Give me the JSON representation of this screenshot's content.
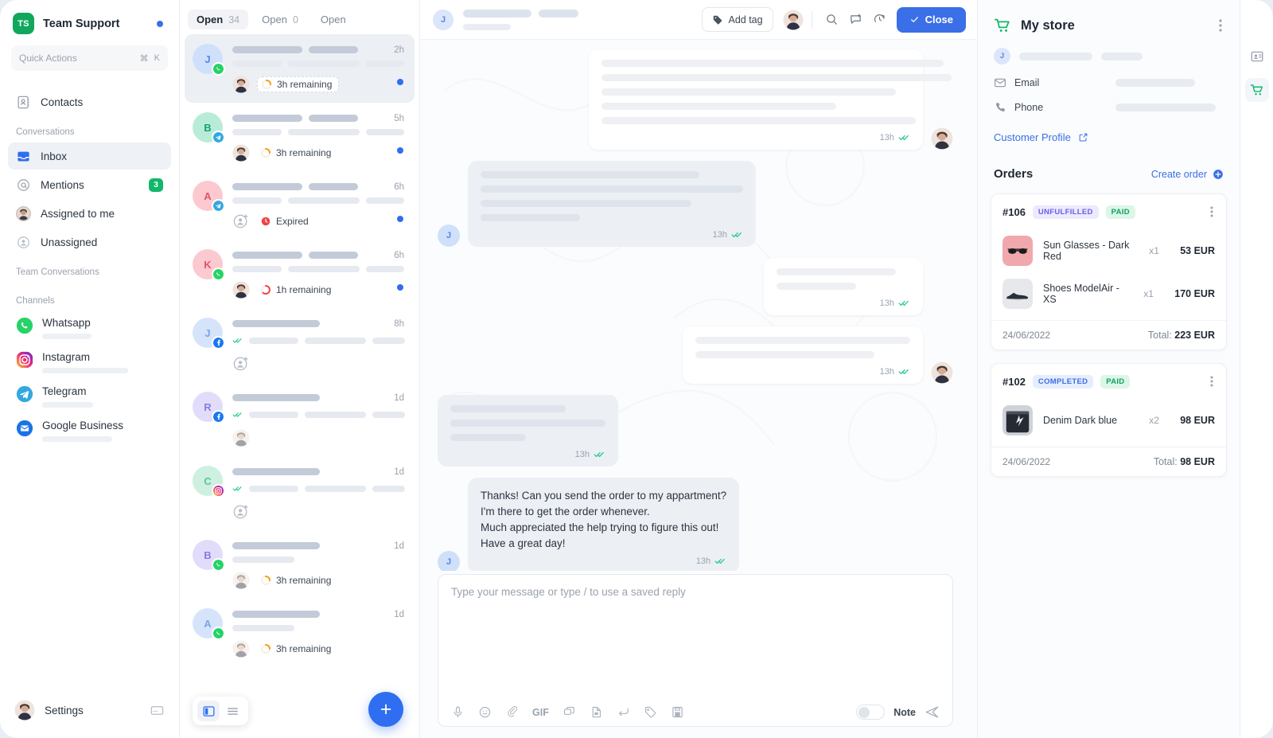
{
  "brand": {
    "logo_text": "TS",
    "name": "Team Support",
    "status_dot_color": "#3b6fe8"
  },
  "quick_actions": {
    "placeholder": "Quick Actions",
    "shortcut_cmd": "⌘",
    "shortcut_key": "K"
  },
  "sidebar": {
    "top_items": [
      {
        "label": "Contacts",
        "icon": "contacts-icon"
      }
    ],
    "conversations_section": "Conversations",
    "conversation_items": [
      {
        "label": "Inbox",
        "icon": "inbox-icon",
        "active": true,
        "badge": ""
      },
      {
        "label": "Mentions",
        "icon": "mention-icon",
        "active": false,
        "badge": "3"
      },
      {
        "label": "Assigned to me",
        "icon": "avatar-icon",
        "active": false,
        "badge": ""
      },
      {
        "label": "Unassigned",
        "icon": "unassigned-icon",
        "active": false,
        "badge": ""
      }
    ],
    "team_section": "Team Conversations",
    "channels_section": "Channels",
    "channels": [
      {
        "label": "Whatsapp",
        "icon": "whatsapp-icon",
        "sub_width": 62
      },
      {
        "label": "Instagram",
        "icon": "instagram-icon",
        "sub_width": 108
      },
      {
        "label": "Telegram",
        "icon": "telegram-icon",
        "sub_width": 64
      },
      {
        "label": "Google Business",
        "icon": "google-business-icon",
        "sub_width": 88
      }
    ],
    "settings_label": "Settings"
  },
  "conversation_list": {
    "tabs": [
      {
        "label": "Open",
        "count": "34",
        "active": true
      },
      {
        "label": "Open",
        "count": "0",
        "active": false
      },
      {
        "label": "Open",
        "count": "",
        "active": false
      }
    ],
    "rows": [
      {
        "initial": "J",
        "avatar_bg": "#cfe0fb",
        "avatar_fg": "#5b85e8",
        "channel": "whatsapp-icon",
        "time": "2h",
        "status_text": "3h remaining",
        "status_icon": "clock-orange-icon",
        "status_style": "dashed",
        "assignee": "photo",
        "unread": true,
        "selected": true,
        "ticks": false
      },
      {
        "initial": "B",
        "avatar_bg": "#b9ecd8",
        "avatar_fg": "#17a26a",
        "channel": "telegram-icon",
        "time": "5h",
        "status_text": "3h remaining",
        "status_icon": "clock-orange-icon",
        "status_style": "plain",
        "assignee": "photo",
        "unread": true,
        "selected": false,
        "ticks": false
      },
      {
        "initial": "A",
        "avatar_bg": "#fbc9cf",
        "avatar_fg": "#e0536a",
        "channel": "telegram-icon",
        "time": "6h",
        "status_text": "Expired",
        "status_icon": "clock-red-icon",
        "status_style": "plain",
        "assignee": "add",
        "unread": true,
        "selected": false,
        "ticks": false
      },
      {
        "initial": "K",
        "avatar_bg": "#fbc9cf",
        "avatar_fg": "#e0536a",
        "channel": "whatsapp-icon",
        "time": "6h",
        "status_text": "1h remaining",
        "status_icon": "clock-red-ring-icon",
        "status_style": "plain",
        "assignee": "photo",
        "unread": true,
        "selected": false,
        "ticks": false
      },
      {
        "initial": "J",
        "avatar_bg": "#d6e4fb",
        "avatar_fg": "#7ea3e8",
        "channel": "facebook-icon",
        "time": "8h",
        "status_text": "",
        "status_icon": "",
        "status_style": "none",
        "assignee": "add",
        "unread": false,
        "selected": false,
        "ticks": true
      },
      {
        "initial": "R",
        "avatar_bg": "#e2dcfb",
        "avatar_fg": "#8b7ae0",
        "channel": "facebook-icon",
        "time": "1d",
        "status_text": "",
        "status_icon": "",
        "status_style": "none",
        "assignee": "photo-faded",
        "unread": false,
        "selected": false,
        "ticks": true
      },
      {
        "initial": "C",
        "avatar_bg": "#cdf0e0",
        "avatar_fg": "#5cc49a",
        "channel": "instagram-icon",
        "time": "1d",
        "status_text": "",
        "status_icon": "",
        "status_style": "none",
        "assignee": "add",
        "unread": false,
        "selected": false,
        "ticks": true
      },
      {
        "initial": "B",
        "avatar_bg": "#e2dcfb",
        "avatar_fg": "#8b7ae0",
        "channel": "whatsapp-icon",
        "time": "1d",
        "status_text": "3h remaining",
        "status_icon": "clock-orange-icon",
        "status_style": "plain",
        "assignee": "photo-faded",
        "unread": false,
        "selected": false,
        "ticks": false
      },
      {
        "initial": "A",
        "avatar_bg": "#d6e4fb",
        "avatar_fg": "#7ea3e8",
        "channel": "whatsapp-icon",
        "time": "1d",
        "status_text": "3h remaining",
        "status_icon": "clock-orange-icon",
        "status_style": "plain",
        "assignee": "photo-faded",
        "unread": false,
        "selected": false,
        "ticks": false
      }
    ],
    "new_conversation_label": "+"
  },
  "chat": {
    "header": {
      "avatar_initial": "J",
      "add_tag_label": "Add tag",
      "close_label": "Close"
    },
    "messages": [
      {
        "dir": "out",
        "type": "skeleton",
        "lines": [
          430,
          440,
          370,
          295,
          395
        ],
        "time": "13h",
        "ticks": true,
        "avatar": "photo"
      },
      {
        "dir": "in",
        "type": "skeleton",
        "lines": [
          275,
          330,
          265,
          125
        ],
        "time": "13h",
        "ticks": true,
        "avatar": "initial"
      },
      {
        "dir": "out",
        "type": "skeleton",
        "lines": [
          150,
          100
        ],
        "time": "13h",
        "ticks": true,
        "avatar": "none"
      },
      {
        "dir": "out",
        "type": "skeleton",
        "lines": [
          270,
          225
        ],
        "time": "13h",
        "ticks": true,
        "avatar": "photo"
      },
      {
        "dir": "in",
        "type": "skeleton",
        "lines": [
          145,
          195,
          95
        ],
        "time": "13h",
        "ticks": true,
        "avatar": "none"
      },
      {
        "dir": "in",
        "type": "text",
        "text": "Thanks! Can you send the order to my appartment?\nI'm there to get the order whenever.\nMuch appreciated the help trying to figure this out!\nHave a great day!",
        "time": "13h",
        "ticks": true,
        "avatar": "initial"
      }
    ],
    "composer": {
      "placeholder": "Type your message or type / to use a saved reply",
      "tools": [
        "mic-icon",
        "emoji-icon",
        "attachment-icon",
        "gif-icon",
        "saved-reply-icon",
        "document-icon",
        "reply-icon",
        "tag-icon",
        "template-icon"
      ],
      "gif_label": "GIF",
      "note_label": "Note"
    }
  },
  "right_panel": {
    "store_title": "My store",
    "customer": {
      "avatar_initial": "J",
      "email_label": "Email",
      "phone_label": "Phone",
      "profile_link": "Customer Profile"
    },
    "orders_title": "Orders",
    "create_order_label": "Create order",
    "orders": [
      {
        "number": "#106",
        "chips": [
          {
            "text": "UNFULFILLED",
            "kind": "unful"
          },
          {
            "text": "PAID",
            "kind": "paid"
          }
        ],
        "items": [
          {
            "name": "Sun Glasses - Dark Red",
            "qty": "x1",
            "price": "53 EUR",
            "thumb": "sunglasses"
          },
          {
            "name": "Shoes ModelAir - XS",
            "qty": "x1",
            "price": "170 EUR",
            "thumb": "shoes"
          }
        ],
        "date": "24/06/2022",
        "total_label": "Total:",
        "total_value": "223 EUR"
      },
      {
        "number": "#102",
        "chips": [
          {
            "text": "COMPLETED",
            "kind": "comp"
          },
          {
            "text": "PAID",
            "kind": "paid"
          }
        ],
        "items": [
          {
            "name": "Denim Dark blue",
            "qty": "x2",
            "price": "98 EUR",
            "thumb": "denim"
          }
        ],
        "date": "24/06/2022",
        "total_label": "Total:",
        "total_value": "98 EUR"
      }
    ]
  },
  "rail": {
    "buttons": [
      {
        "icon": "contact-card-icon",
        "active": false
      },
      {
        "icon": "cart-icon",
        "active": true
      }
    ]
  },
  "colors": {
    "accent_blue": "#3b6fe8",
    "green": "#12b76a",
    "unread": "#2f6ef0"
  }
}
